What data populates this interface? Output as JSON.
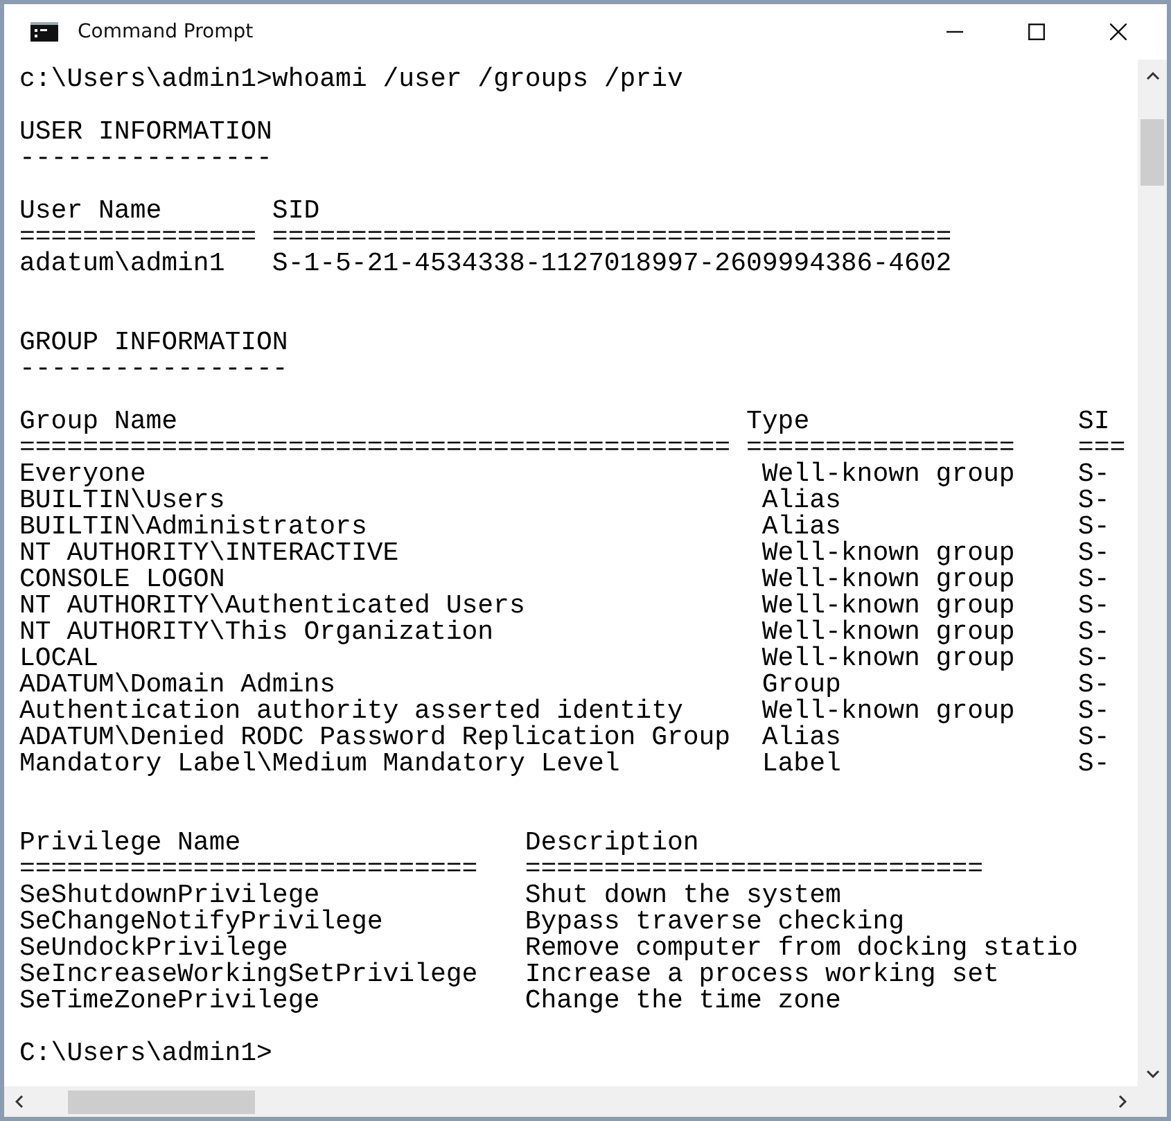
{
  "window": {
    "title": "Command Prompt"
  },
  "console": {
    "blocks": [
      {
        "kind": "prompt",
        "text": "c:\\Users\\admin1>whoami /user /groups /priv"
      },
      {
        "kind": "heading",
        "text": "USER INFORMATION",
        "rule": "----------------"
      },
      {
        "kind": "table",
        "columns": [
          {
            "heading": "User Name",
            "rule": "==============="
          },
          {
            "heading": "SID",
            "rule": "==========================================="
          }
        ],
        "rows": [
          [
            "adatum\\admin1",
            "S-1-5-21-4534338-1127018997-2609994386-4602"
          ]
        ]
      },
      {
        "kind": "heading",
        "text": "GROUP INFORMATION",
        "rule": "-----------------"
      },
      {
        "kind": "table",
        "columns": [
          {
            "heading": "Group Name",
            "rule": "============================================="
          },
          {
            "heading": "Type",
            "rule": "================="
          },
          {
            "heading": "SI",
            "rule": "==="
          }
        ],
        "rows": [
          [
            "Everyone",
            "Well-known group",
            "S-"
          ],
          [
            "BUILTIN\\Users",
            "Alias",
            "S-"
          ],
          [
            "BUILTIN\\Administrators",
            "Alias",
            "S-"
          ],
          [
            "NT AUTHORITY\\INTERACTIVE",
            "Well-known group",
            "S-"
          ],
          [
            "CONSOLE LOGON",
            "Well-known group",
            "S-"
          ],
          [
            "NT AUTHORITY\\Authenticated Users",
            "Well-known group",
            "S-"
          ],
          [
            "NT AUTHORITY\\This Organization",
            "Well-known group",
            "S-"
          ],
          [
            "LOCAL",
            "Well-known group",
            "S-"
          ],
          [
            "ADATUM\\Domain Admins",
            "Group",
            "S-"
          ],
          [
            "Authentication authority asserted identity",
            "Well-known group",
            "S-"
          ],
          [
            "ADATUM\\Denied RODC Password Replication Group",
            "Alias",
            "S-"
          ],
          [
            "Mandatory Label\\Medium Mandatory Level",
            "Label",
            "S-"
          ]
        ]
      },
      {
        "kind": "table",
        "columns": [
          {
            "heading": "Privilege Name",
            "rule": "============================="
          },
          {
            "heading": "Description",
            "rule": "============================="
          }
        ],
        "rows": [
          [
            "SeShutdownPrivilege",
            "Shut down the system"
          ],
          [
            "SeChangeNotifyPrivilege",
            "Bypass traverse checking"
          ],
          [
            "SeUndockPrivilege",
            "Remove computer from docking statio"
          ],
          [
            "SeIncreaseWorkingSetPrivilege",
            "Increase a process working set"
          ],
          [
            "SeTimeZonePrivilege",
            "Change the time zone"
          ]
        ]
      },
      {
        "kind": "prompt",
        "text": "C:\\Users\\admin1>"
      }
    ]
  }
}
